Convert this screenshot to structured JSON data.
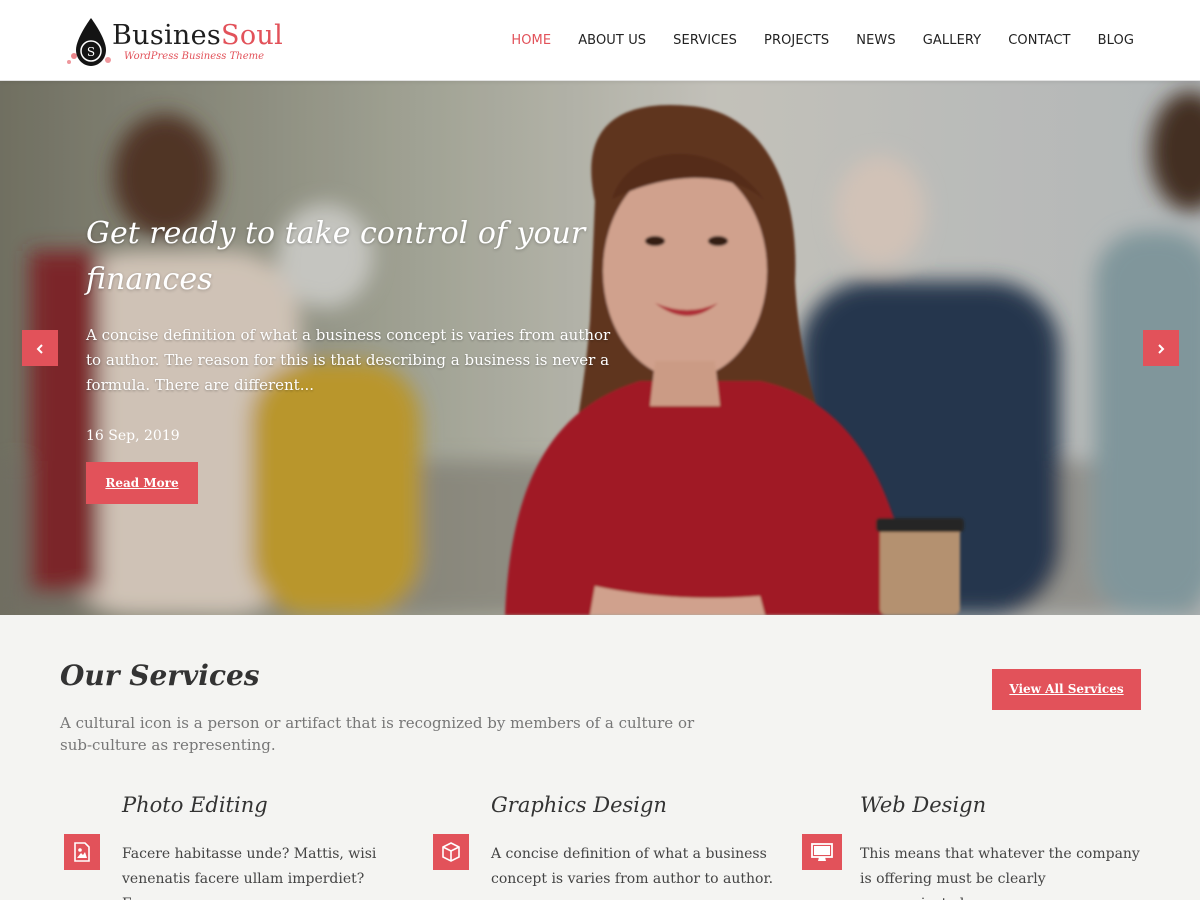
{
  "brand": {
    "name_part1": "Busines",
    "name_part2": "Soul",
    "tagline": "WordPress Business Theme",
    "accent_color": "#e2525a"
  },
  "nav": {
    "items": [
      {
        "label": "HOME",
        "active": true
      },
      {
        "label": "ABOUT US"
      },
      {
        "label": "SERVICES"
      },
      {
        "label": "PROJECTS"
      },
      {
        "label": "NEWS"
      },
      {
        "label": "GALLERY"
      },
      {
        "label": "CONTACT"
      },
      {
        "label": "BLOG"
      }
    ]
  },
  "hero": {
    "title": "Get ready to take control of your finances",
    "description": "A concise definition of what a business concept is varies from author to author. The reason for this is that describing a business is never a formula. There are different...",
    "date": "16  Sep, 2019",
    "button_label": "Read More",
    "prev_icon": "chevron-left-icon",
    "next_icon": "chevron-right-icon"
  },
  "services": {
    "title": "Our Services",
    "description": "A cultural icon is a person or artifact that is recognized by members of a culture or sub-culture as representing.",
    "view_all_label": "View All Services",
    "items": [
      {
        "title": "Photo Editing",
        "text": "Facere habitasse unde? Mattis, wisi venenatis facere ullam imperdiet? Eaque",
        "icon": "image-icon"
      },
      {
        "title": "Graphics Design",
        "text": "A concise definition of what a business concept is varies from author to author.",
        "icon": "cube-icon"
      },
      {
        "title": "Web Design",
        "text": "This means that whatever the company is offering must be clearly communicated",
        "icon": "monitor-icon"
      }
    ]
  }
}
